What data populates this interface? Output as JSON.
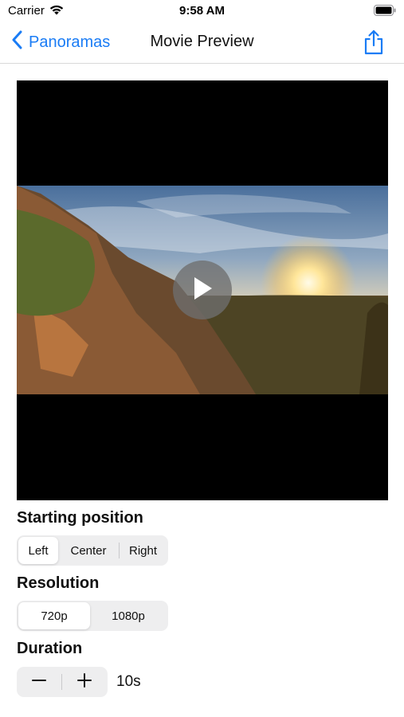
{
  "status_bar": {
    "carrier": "Carrier",
    "time": "9:58 AM"
  },
  "nav": {
    "back_label": "Panoramas",
    "title": "Movie Preview",
    "accent_color": "#1a7cf5"
  },
  "video": {
    "play_icon": "play-icon"
  },
  "starting_position": {
    "label": "Starting position",
    "options": [
      "Left",
      "Center",
      "Right"
    ],
    "selected": "Left"
  },
  "resolution": {
    "label": "Resolution",
    "options": [
      "720p",
      "1080p"
    ],
    "selected": "720p"
  },
  "duration": {
    "label": "Duration",
    "value": "10s",
    "decrement_icon": "minus-icon",
    "increment_icon": "plus-icon"
  }
}
